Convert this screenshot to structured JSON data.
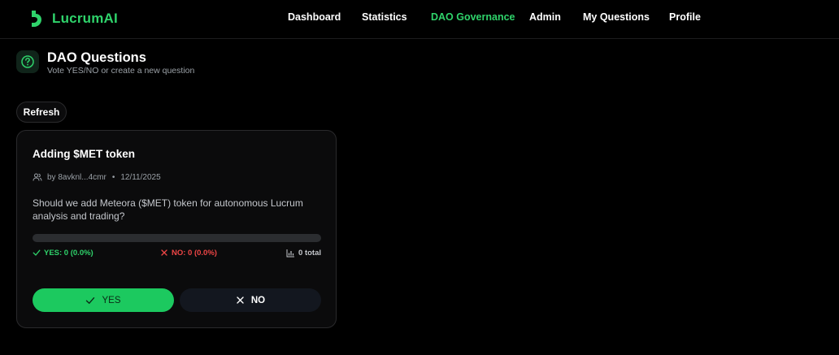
{
  "app": {
    "name": "LucrumAI",
    "accent_color": "#2fd36b",
    "logo_icon": "lucrum-logo-icon"
  },
  "nav": {
    "items": [
      {
        "label": "Dashboard",
        "active": false
      },
      {
        "label": "Statistics",
        "active": false
      },
      {
        "label": "DAO Governance",
        "active": true
      },
      {
        "label": "Admin",
        "active": false
      },
      {
        "label": "My Questions",
        "active": false
      },
      {
        "label": "Profile",
        "active": false
      }
    ]
  },
  "header": {
    "icon": "question-circle-icon",
    "title": "DAO Questions",
    "subtitle": "Vote YES/NO or create a new question"
  },
  "toolbar": {
    "refresh_label": "Refresh"
  },
  "question": {
    "title": "Adding $MET token",
    "author_icon": "users-icon",
    "author": "by 8avknl...4cmr",
    "separator": "•",
    "date": "12/11/2025",
    "text": "Should we add Meteora ($MET) token for autonomous Lucrum analysis and trading?",
    "yes_fraction": 0,
    "stats": {
      "yes_icon": "check-icon",
      "yes_text": "YES: 0 (0.0%)",
      "no_icon": "x-icon",
      "no_text": "NO: 0 (0.0%)",
      "total_icon": "bar-chart-icon",
      "total_text": "0 total"
    },
    "buttons": {
      "yes_label": "YES",
      "no_label": "NO"
    },
    "colors": {
      "yes": "#2fd36b",
      "no": "#f04646"
    }
  }
}
